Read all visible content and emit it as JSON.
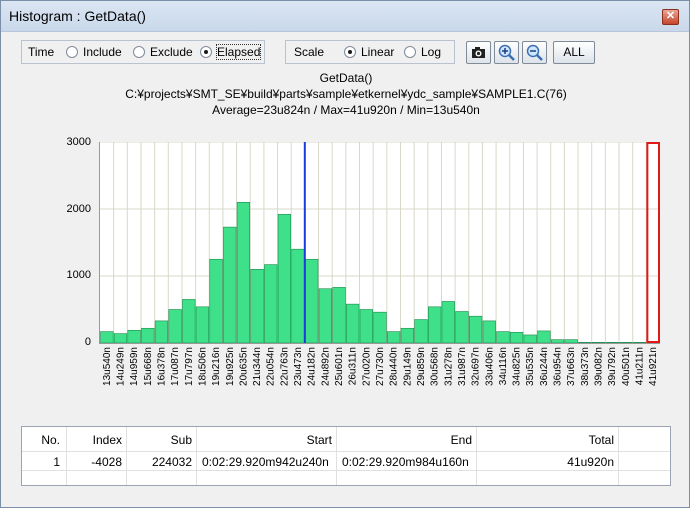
{
  "window": {
    "title": "Histogram : GetData()",
    "close_glyph": "✕"
  },
  "toolbar": {
    "time_label": "Time",
    "time_options": [
      "Include",
      "Exclude",
      "Elapsed"
    ],
    "time_selected": "Elapsed",
    "scale_label": "Scale",
    "scale_options": [
      "Linear",
      "Log"
    ],
    "scale_selected": "Linear",
    "all_label": "ALL",
    "icons": [
      "camera-icon",
      "zoom-in-icon",
      "zoom-out-icon"
    ]
  },
  "info": {
    "function": "GetData()",
    "path": "C:¥projects¥SMT_SE¥build¥parts¥sample¥etkernel¥ydc_sample¥SAMPLE1.C(76)",
    "stats": "Average=23u824n / Max=41u920n / Min=13u540n"
  },
  "chart_data": {
    "type": "bar",
    "categories": [
      "13u540n",
      "14u249n",
      "14u959n",
      "15u668n",
      "16u378n",
      "17u087n",
      "17u797n",
      "18u506n",
      "19u216n",
      "19u925n",
      "20u635n",
      "21u344n",
      "22u054n",
      "22u763n",
      "23u473n",
      "24u182n",
      "24u892n",
      "25u601n",
      "26u311n",
      "27u020n",
      "27u730n",
      "28u440n",
      "29u149n",
      "29u859n",
      "30u568n",
      "31u278n",
      "31u987n",
      "32u697n",
      "33u406n",
      "34u116n",
      "34u825n",
      "35u535n",
      "36u244n",
      "36u954n",
      "37u663n",
      "38u373n",
      "39u082n",
      "39u792n",
      "40u501n",
      "41u211n",
      "41u921n"
    ],
    "values": [
      170,
      140,
      190,
      220,
      330,
      500,
      650,
      540,
      1250,
      1730,
      2100,
      1100,
      1170,
      1920,
      1400,
      1250,
      810,
      830,
      580,
      500,
      460,
      170,
      220,
      350,
      540,
      620,
      470,
      400,
      330,
      170,
      160,
      120,
      180,
      50,
      50,
      10,
      10,
      10,
      10,
      10,
      10
    ],
    "ylim": [
      0,
      3000
    ],
    "yticks": [
      "3000",
      "2000",
      "1000",
      "0"
    ],
    "grid": true,
    "bar_color": "#3ee08a",
    "average_marker_value": "23u824n",
    "average_marker_color": "#1a3ed6",
    "selected_bin": "41u921n",
    "selected_color": "#e01818"
  },
  "table": {
    "headers": [
      "No.",
      "Index",
      "Sub",
      "Start",
      "End",
      "Total"
    ],
    "rows": [
      [
        "1",
        "-4028",
        "224032",
        "0:02:29.920m942u240n",
        "0:02:29.920m984u160n",
        "41u920n"
      ]
    ]
  }
}
